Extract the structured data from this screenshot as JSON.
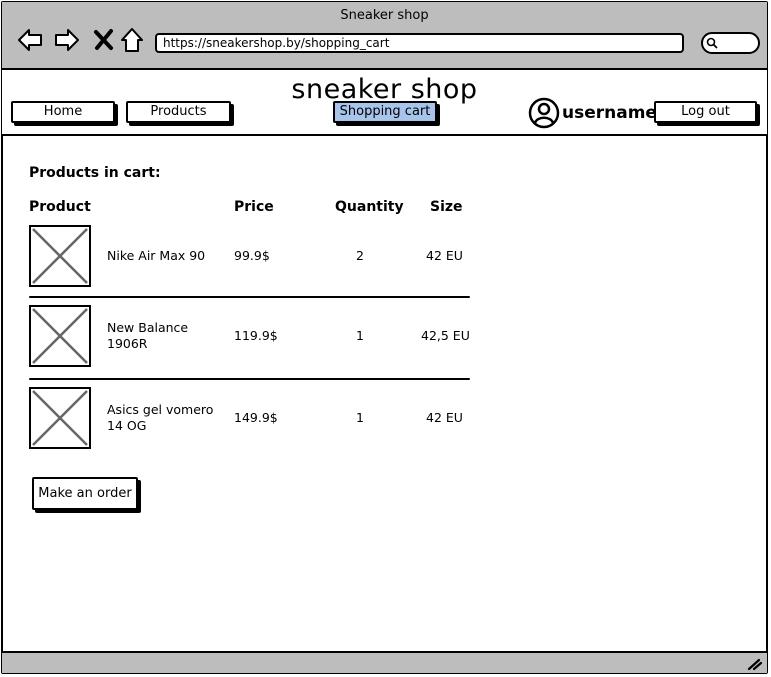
{
  "window": {
    "title": "Sneaker shop",
    "url": "https://sneakershop.by/shopping_cart"
  },
  "header": {
    "site_title": "sneaker shop",
    "nav": {
      "home": "Home",
      "products": "Products",
      "cart": "Shopping cart",
      "logout": "Log out"
    },
    "username": "username"
  },
  "cart": {
    "heading": "Products in cart:",
    "columns": {
      "product": "Product",
      "price": "Price",
      "quantity": "Quantity",
      "size": "Size"
    },
    "items": [
      {
        "name": "Nike Air Max 90",
        "price": "99.9$",
        "quantity": "2",
        "size": "42 EU"
      },
      {
        "name": "New Balance 1906R",
        "price": "119.9$",
        "quantity": "1",
        "size": "42,5 EU"
      },
      {
        "name": "Asics gel vomero 14 OG",
        "price": "149.9$",
        "quantity": "1",
        "size": "42 EU"
      }
    ],
    "order_button": "Make an order"
  },
  "colors": {
    "chrome": "#bdbdbd",
    "active_tab": "#a9c4eb"
  },
  "icons": [
    "back-icon",
    "forward-icon",
    "close-icon",
    "home-icon",
    "search-icon",
    "user-avatar-icon",
    "image-placeholder-icon"
  ]
}
